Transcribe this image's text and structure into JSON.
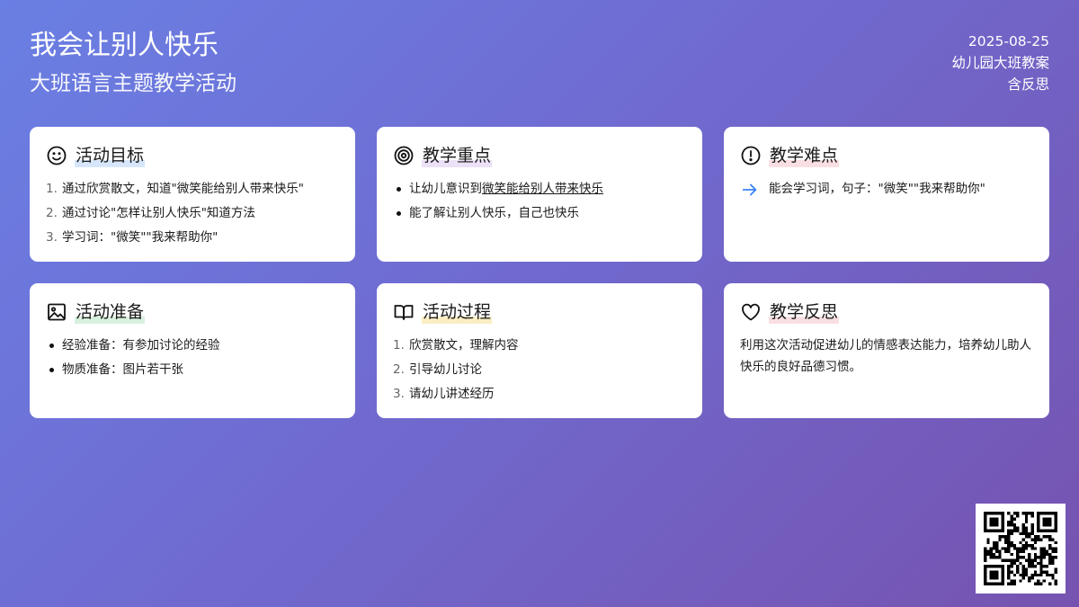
{
  "header": {
    "title": "我会让别人快乐",
    "subtitle": "大班语言主题教学活动",
    "date": "2025-08-25",
    "meta_1": "幼儿园大班教案",
    "meta_2": "含反思"
  },
  "cards": {
    "goals": {
      "title": "活动目标",
      "icon": "smile-icon",
      "items": [
        {
          "num": "1.",
          "text": "通过欣赏散文，知道\"微笑能给别人带来快乐\""
        },
        {
          "num": "2.",
          "text": "通过讨论\"怎样让别人快乐\"知道方法"
        },
        {
          "num": "3.",
          "text": "学习词：\"微笑\"\"我来帮助你\""
        }
      ]
    },
    "key_points": {
      "title": "教学重点",
      "icon": "target-icon",
      "item1_prefix": "让幼儿意识到",
      "item1_underlined": "微笑能给别人带来快乐",
      "item2": "能了解让别人快乐，自己也快乐"
    },
    "difficulty": {
      "title": "教学难点",
      "icon": "alert-icon",
      "text": "能会学习词，句子：\"微笑\"\"我来帮助你\""
    },
    "preparation": {
      "title": "活动准备",
      "icon": "image-icon",
      "items": [
        "经验准备：有参加讨论的经验",
        "物质准备：图片若干张"
      ]
    },
    "process": {
      "title": "活动过程",
      "icon": "book-icon",
      "items": [
        {
          "num": "1.",
          "text": "欣赏散文，理解内容"
        },
        {
          "num": "2.",
          "text": "引导幼儿讨论"
        },
        {
          "num": "3.",
          "text": "请幼儿讲述经历"
        }
      ]
    },
    "reflection": {
      "title": "教学反思",
      "icon": "heart-icon",
      "text": "利用这次活动促进幼儿的情感表达能力，培养幼儿助人快乐的良好品德习惯。"
    }
  },
  "qr_code": {
    "icon": "qr-code-icon"
  },
  "colors": {
    "bg_start": "#6a7fe3",
    "bg_end": "#7653b0",
    "arrow": "#3b82f6"
  }
}
